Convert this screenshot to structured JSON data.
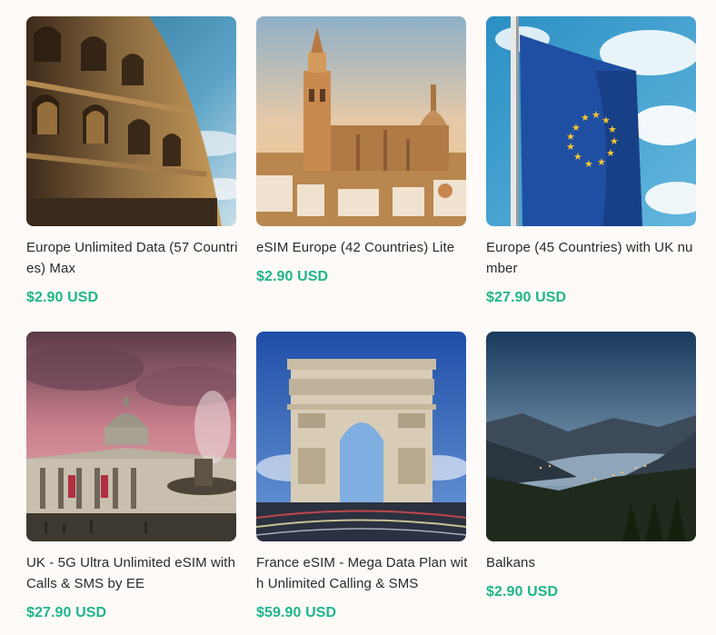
{
  "products": [
    {
      "title": "Europe Unlimited Data (57 Countries) Max",
      "price": "$2.90 USD",
      "image": "colosseum-image"
    },
    {
      "title": "eSIM Europe (42 Countries) Lite",
      "price": "$2.90 USD",
      "image": "seville-cathedral-image"
    },
    {
      "title": "Europe (45 Countries) with UK number",
      "price": "$27.90 USD",
      "image": "eu-flag-image"
    },
    {
      "title": "UK - 5G Ultra Unlimited eSIM with Calls & SMS by EE",
      "price": "$27.90 USD",
      "image": "london-gallery-image"
    },
    {
      "title": "France eSIM - Mega Data Plan with Unlimited Calling & SMS",
      "price": "$59.90 USD",
      "image": "arc-de-triomphe-image"
    },
    {
      "title": "Balkans",
      "price": "$2.90 USD",
      "image": "kotor-bay-image"
    }
  ],
  "colors": {
    "price": "#1fb58a",
    "title": "#2b2b2b",
    "background": "#fdfaf7"
  }
}
